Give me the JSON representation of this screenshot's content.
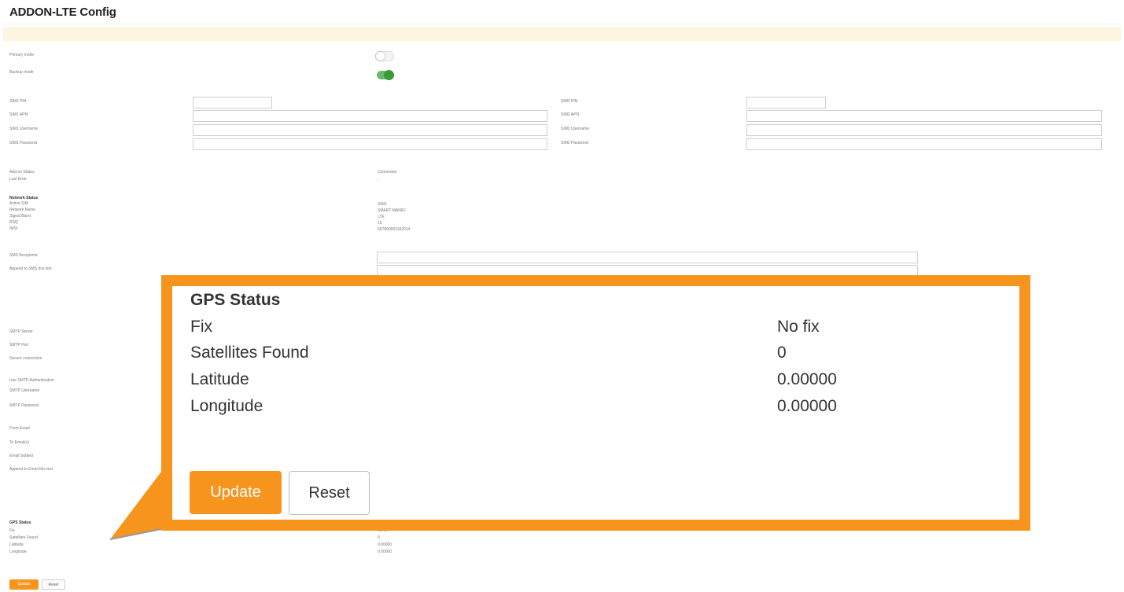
{
  "page": {
    "title": "ADDON-LTE Config"
  },
  "modes": {
    "primary_label": "Primary mode",
    "backup_label": "Backup mode",
    "primary_on": false,
    "backup_on": true
  },
  "sim1": {
    "pin_label": "SIM1 PIN",
    "apn_label": "SIM1 APN",
    "username_label": "SIM1 Username",
    "password_label": "SIM1 Password"
  },
  "sim2": {
    "pin_label": "SIM2 PIN",
    "apn_label": "SIM2 APN",
    "username_label": "SIM2 Username",
    "password_label": "SIM2 Password"
  },
  "status": {
    "addon_status_label": "Add-on Status",
    "addon_status_value": "Connected",
    "last_error_label": "Last Error",
    "last_error_value": "-"
  },
  "network": {
    "heading": "Network Status",
    "active_sim_label": "Active SIM",
    "active_sim_value": "SIM1",
    "network_name_label": "Network Name",
    "network_name_value": "SMART MANIFI",
    "signal_band_label": "Signal Band",
    "signal_band_value": "LTE",
    "rsq_label": "RSQ",
    "rsq_value": "15",
    "imsi_label": "IMSI",
    "imsi_value": "607890001182014"
  },
  "sms": {
    "recipients_label": "SMS Recipients",
    "append_label": "Append to SMS this text"
  },
  "smtp": {
    "server_label": "SMTP Server",
    "port_label": "SMTP Port",
    "secure_label": "Secure connection",
    "use_auth_label": "Use SMTP Authentication",
    "username_label": "SMTP Username",
    "password_label": "SMTP Password",
    "from_label": "From Email",
    "to_label": "To Email(s)",
    "subject_label": "Email Subject",
    "append_label": "Append to Email this text"
  },
  "gps_small": {
    "heading": "GPS Status",
    "fix_label": "Fix",
    "fix_value": "No fix",
    "sats_label": "Satellites Found",
    "sats_value": "0",
    "lat_label": "Latitude",
    "lat_value": "0.00000",
    "lon_label": "Longitude",
    "lon_value": "0.00000"
  },
  "buttons": {
    "update": "Update",
    "reset": "Reset"
  },
  "callout": {
    "heading": "GPS Status",
    "rows": [
      {
        "label": "Fix",
        "value": "No fix"
      },
      {
        "label": "Satellites Found",
        "value": "0"
      },
      {
        "label": "Latitude",
        "value": "0.00000"
      },
      {
        "label": "Longitude",
        "value": "0.00000"
      }
    ],
    "update_label": "Update",
    "reset_label": "Reset"
  },
  "colors": {
    "accent": "#f7941d",
    "toggle_on": "#3a9a3a",
    "notice_bg": "#fcf6e0"
  }
}
